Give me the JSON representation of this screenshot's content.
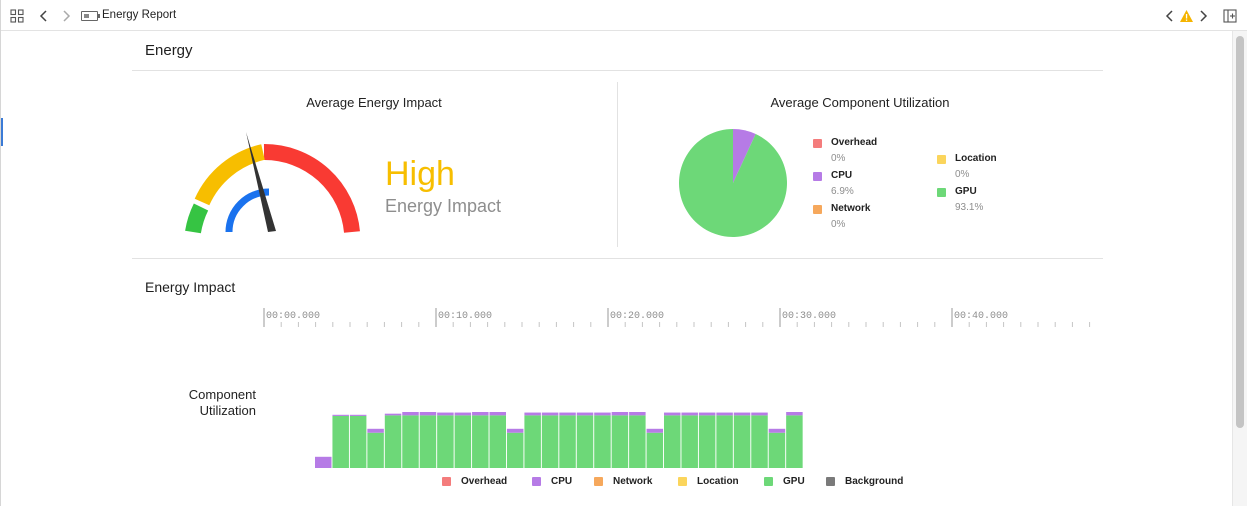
{
  "toolbar": {
    "title": "Energy Report"
  },
  "sections": {
    "energy_heading": "Energy",
    "impact_heading": "Energy Impact"
  },
  "average_energy": {
    "title": "Average Energy Impact",
    "level": "High",
    "subtitle": "Energy Impact",
    "level_color": "#f7be00"
  },
  "component_utilization": {
    "title": "Average Component Utilization",
    "legend": [
      {
        "name": "Overhead",
        "pct": "0%",
        "color": "#f47c7c"
      },
      {
        "name": "CPU",
        "pct": "6.9%",
        "color": "#b67be6"
      },
      {
        "name": "Network",
        "pct": "0%",
        "color": "#f6a85c"
      },
      {
        "name": "Location",
        "pct": "0%",
        "color": "#fbd55c"
      },
      {
        "name": "GPU",
        "pct": "93.1%",
        "color": "#6dd878"
      }
    ]
  },
  "timeline": {
    "ticks": [
      "00:00.000",
      "00:10.000",
      "00:20.000",
      "00:30.000",
      "00:40.000"
    ],
    "row_label_line1": "Component",
    "row_label_line2": "Utilization"
  },
  "bottom_legend": [
    {
      "name": "Overhead",
      "color": "#f47c7c"
    },
    {
      "name": "CPU",
      "color": "#b67be6"
    },
    {
      "name": "Network",
      "color": "#f6a85c"
    },
    {
      "name": "Location",
      "color": "#fbd55c"
    },
    {
      "name": "GPU",
      "color": "#6dd878"
    },
    {
      "name": "Background",
      "color": "#7a7a7a"
    }
  ],
  "chart_data": {
    "type": "bar",
    "stacked": true,
    "series": [
      {
        "name": "GPU",
        "values": [
          0,
          0.93,
          0.93,
          0.63,
          0.94,
          0.94,
          0.94,
          0.94,
          0.94,
          0.94,
          0.94,
          0.63,
          0.94,
          0.94,
          0.94,
          0.94,
          0.94,
          0.94,
          0.94,
          0.63,
          0.94,
          0.94,
          0.94,
          0.94,
          0.94,
          0.94,
          0.63,
          0.94
        ]
      },
      {
        "name": "CPU",
        "values": [
          0.2,
          0.02,
          0.02,
          0.07,
          0.03,
          0.07,
          0.07,
          0.05,
          0.05,
          0.07,
          0.07,
          0.07,
          0.05,
          0.05,
          0.05,
          0.05,
          0.05,
          0.07,
          0.07,
          0.07,
          0.05,
          0.05,
          0.05,
          0.05,
          0.05,
          0.05,
          0.07,
          0.08
        ]
      }
    ]
  }
}
